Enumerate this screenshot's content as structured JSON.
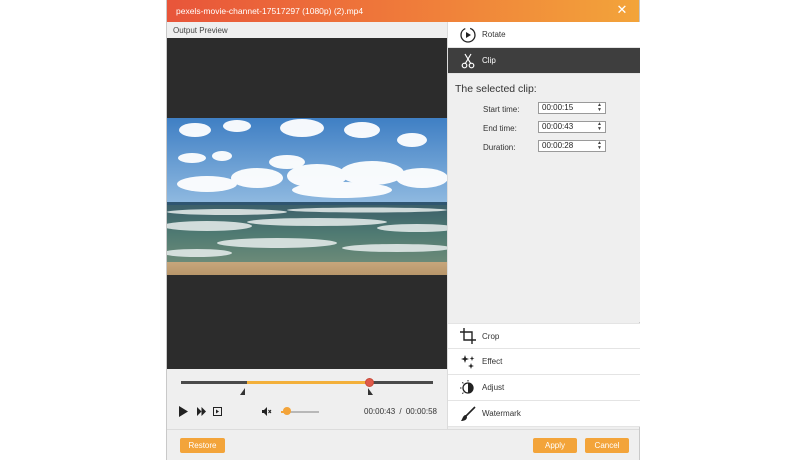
{
  "window": {
    "title": "pexels-movie-channet-17517297 (1080p) (2).mp4",
    "accent_colors": [
      "#e8553a",
      "#f3a43a"
    ]
  },
  "preview": {
    "label": "Output Preview"
  },
  "player": {
    "current_time": "00:00:43",
    "separator": "/",
    "total_time": "00:00:58",
    "playhead_fraction": 0.74,
    "selection_start_fraction": 0.26,
    "selection_end_fraction": 0.74,
    "volume_fraction": 0.15
  },
  "tools": {
    "rotate": "Rotate",
    "clip": "Clip",
    "crop": "Crop",
    "effect": "Effect",
    "adjust": "Adjust",
    "watermark": "Watermark"
  },
  "clip": {
    "heading": "The selected clip:",
    "start_label": "Start time:",
    "start_value": "00:00:15",
    "end_label": "End time:",
    "end_value": "00:00:43",
    "duration_label": "Duration:",
    "duration_value": "00:00:28"
  },
  "footer": {
    "restore": "Restore",
    "apply": "Apply",
    "cancel": "Cancel"
  }
}
